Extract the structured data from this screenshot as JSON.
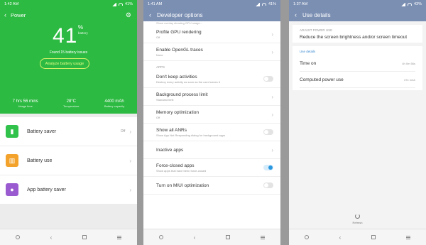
{
  "panel1": {
    "status_time": "1:42 AM",
    "status_battery": "41%",
    "title": "Power",
    "battery_value": "41",
    "percent_sign": "%",
    "battery_caption": "battery",
    "issues_text": "Found 15 battery issues",
    "analyze_label": "Analyze battery usage",
    "stats": [
      {
        "value": "7 hrs 56 mins",
        "caption": "Usage time"
      },
      {
        "value": "28°C",
        "caption": "Temperature"
      },
      {
        "value": "4400 mAh",
        "caption": "Battery capacity"
      }
    ],
    "items": [
      {
        "label": "Battery saver",
        "value": "Off",
        "color": "#31c24b",
        "icon": "battery-saver-icon"
      },
      {
        "label": "Battery use",
        "value": "",
        "color": "#f3a32b",
        "icon": "battery-use-icon"
      },
      {
        "label": "App battery saver",
        "value": "",
        "color": "#9a5bd0",
        "icon": "app-battery-saver-icon"
      }
    ]
  },
  "panel2": {
    "status_time": "1:41 AM",
    "status_battery": "41%",
    "title": "Developer options",
    "partial_text": "Show overlay showing GPU usage...",
    "rows_a": [
      {
        "title": "Profile GPU rendering",
        "sub": "Off",
        "control": "chevron"
      },
      {
        "title": "Enable OpenGL traces",
        "sub": "None",
        "control": "chevron"
      }
    ],
    "section_apps": "APPS",
    "rows_b": [
      {
        "title": "Don't keep activities",
        "sub": "Destroy every activity as soon as the user leaves it",
        "control": "toggle-off"
      },
      {
        "title": "Background process limit",
        "sub": "Standard limit",
        "control": "chevron"
      },
      {
        "title": "Memory optimization",
        "sub": "Off",
        "control": "chevron"
      },
      {
        "title": "Show all ANRs",
        "sub": "Show App Not Responding dialog for background apps",
        "control": "toggle-off"
      },
      {
        "title": "Inactive apps",
        "sub": "",
        "control": "chevron"
      },
      {
        "title": "Force-closed apps",
        "sub": "Show apps that have been force-closed",
        "control": "toggle-on"
      },
      {
        "title": "Turn on MIUI optimization",
        "sub": "",
        "control": "toggle-off"
      }
    ]
  },
  "panel3": {
    "status_time": "1:37 AM",
    "status_battery": "43%",
    "title": "Use details",
    "adjust_section": "ADJUST POWER USE",
    "adjust_text": "Reduce the screen brightness and/or screen timeout",
    "use_section": "Use details",
    "rows": [
      {
        "title": "Time on",
        "value": "4h 0m 56s"
      },
      {
        "title": "Computed power use",
        "value": "374 mAh"
      }
    ],
    "refresh_label": "Refresh"
  }
}
